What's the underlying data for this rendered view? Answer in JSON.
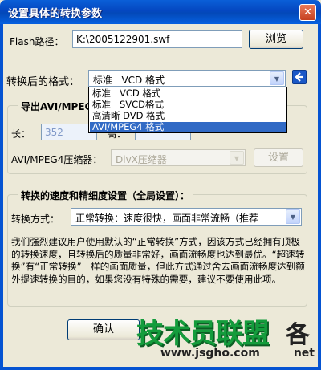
{
  "window": {
    "title": "设置具体的转换参数",
    "close_glyph": "✕"
  },
  "flash": {
    "label": "Flash路径：",
    "path": "K:\\2005122901.swf",
    "browse_label": "浏览"
  },
  "format": {
    "label": "转换后的格式：",
    "selected": "标准   VCD 格式",
    "options": [
      "标准   VCD 格式",
      "标准   SVCD格式",
      "高清晰 DVD 格式",
      "AVI/MPEG4 格式"
    ],
    "highlighted_index": 3
  },
  "export_group": {
    "title": "导出AVI/MPEG",
    "width_label": "长：",
    "width_value": "352",
    "height_label": "高："
  },
  "compressor": {
    "label": "AVI/MPEG4压缩器：",
    "value": "DivX压缩器",
    "settings_label": "设置"
  },
  "speed_group": {
    "title": "转换的速度和精细度设置（全局设置）：",
    "mode_label": "转换方式：",
    "mode_value": "正常转换：速度很快，画面非常流畅（推荐"
  },
  "description": "我们强烈建议用户使用默认的“正常转换”方式，因该方式已经拥有顶极的转换速度，且转换后的质量非常好，画面流畅度也达到最优。“超速转换”有“正常转换”一样的画面质量，但此方式通过舍去画面流畅度达到额外提速转换的目的，如果您没有特殊的需要，建议不要使用此项。",
  "footer": {
    "ok_label": "确认"
  },
  "watermark": {
    "brand": "技术员联盟",
    "tail": "各",
    "url": "www.jsgho.com",
    "net": "net"
  },
  "colors": {
    "titlebar": "#0553d2",
    "selection": "#316ac5",
    "watermark_green": "#149c3c"
  }
}
